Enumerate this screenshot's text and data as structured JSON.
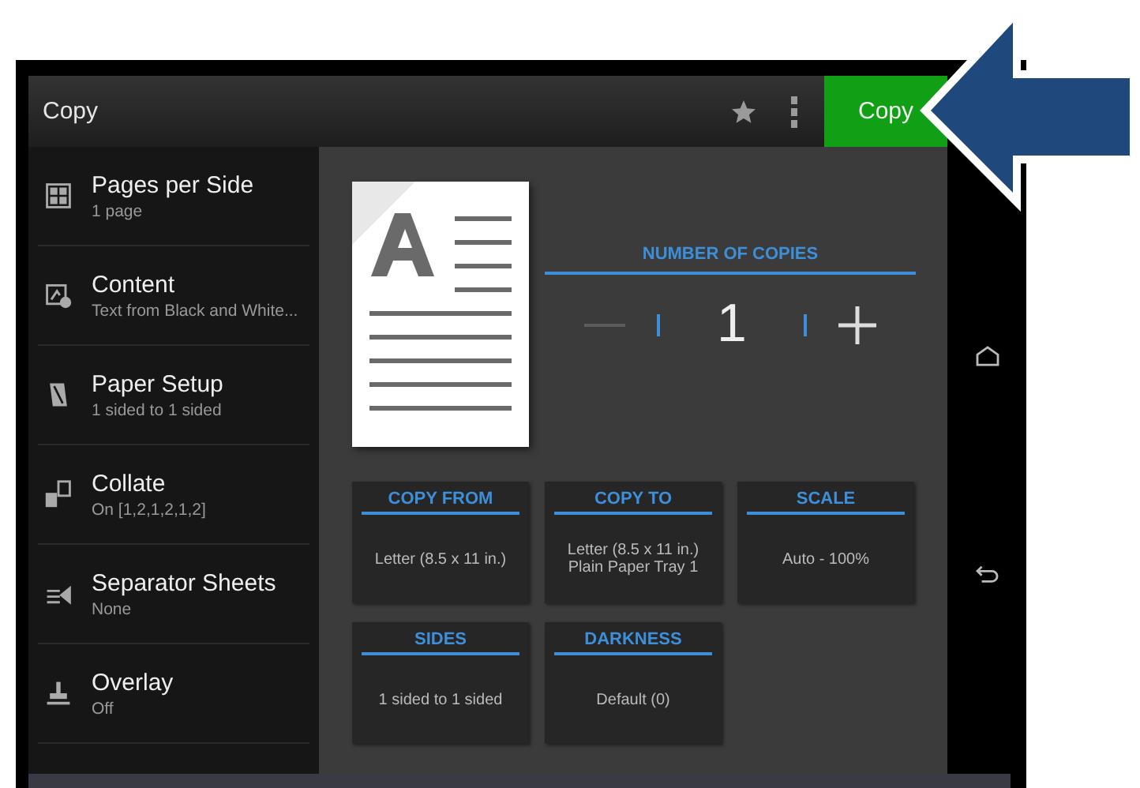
{
  "app_bar": {
    "title": "Copy",
    "action": "Copy"
  },
  "settings": [
    {
      "kind": "pages",
      "label": "Pages per Side",
      "value": "1 page"
    },
    {
      "kind": "content",
      "label": "Content",
      "value": "Text from Black and White..."
    },
    {
      "kind": "paper",
      "label": "Paper Setup",
      "value": "1 sided to 1 sided"
    },
    {
      "kind": "collate",
      "label": "Collate",
      "value": "On [1,2,1,2,1,2]"
    },
    {
      "kind": "separator",
      "label": "Separator Sheets",
      "value": "None"
    },
    {
      "kind": "overlay",
      "label": "Overlay",
      "value": "Off"
    }
  ],
  "copies": {
    "label": "NUMBER OF COPIES",
    "value": "1",
    "decrement_disabled": true
  },
  "tiles": [
    {
      "title": "COPY FROM",
      "lines": [
        "Letter (8.5 x 11 in.)"
      ]
    },
    {
      "title": "COPY TO",
      "lines": [
        "Letter (8.5 x 11 in.)",
        "Plain Paper Tray 1"
      ]
    },
    {
      "title": "SCALE",
      "lines": [
        "Auto - 100%"
      ]
    },
    {
      "title": "SIDES",
      "lines": [
        "1 sided to 1 sided"
      ]
    },
    {
      "title": "DARKNESS",
      "lines": [
        "Default (0)"
      ]
    }
  ]
}
